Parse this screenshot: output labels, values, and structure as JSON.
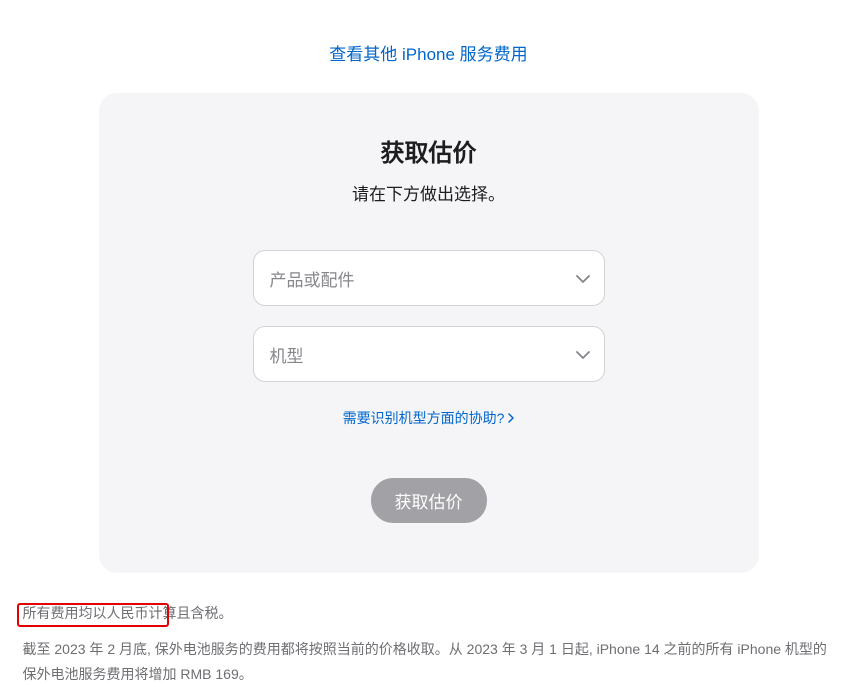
{
  "top_link": {
    "label": "查看其他 iPhone 服务费用"
  },
  "card": {
    "title": "获取估价",
    "subtitle": "请在下方做出选择。",
    "select_product_placeholder": "产品或配件",
    "select_model_placeholder": "机型",
    "help_link": "需要识别机型方面的协助?",
    "submit_label": "获取估价"
  },
  "footer": {
    "line1": "所有费用均以人民币计算且含税。",
    "line2": "截至 2023 年 2 月底, 保外电池服务的费用都将按照当前的价格收取。从 2023 年 3 月 1 日起, iPhone 14 之前的所有 iPhone 机型的保外电池服务费用将增加 RMB 169。"
  }
}
